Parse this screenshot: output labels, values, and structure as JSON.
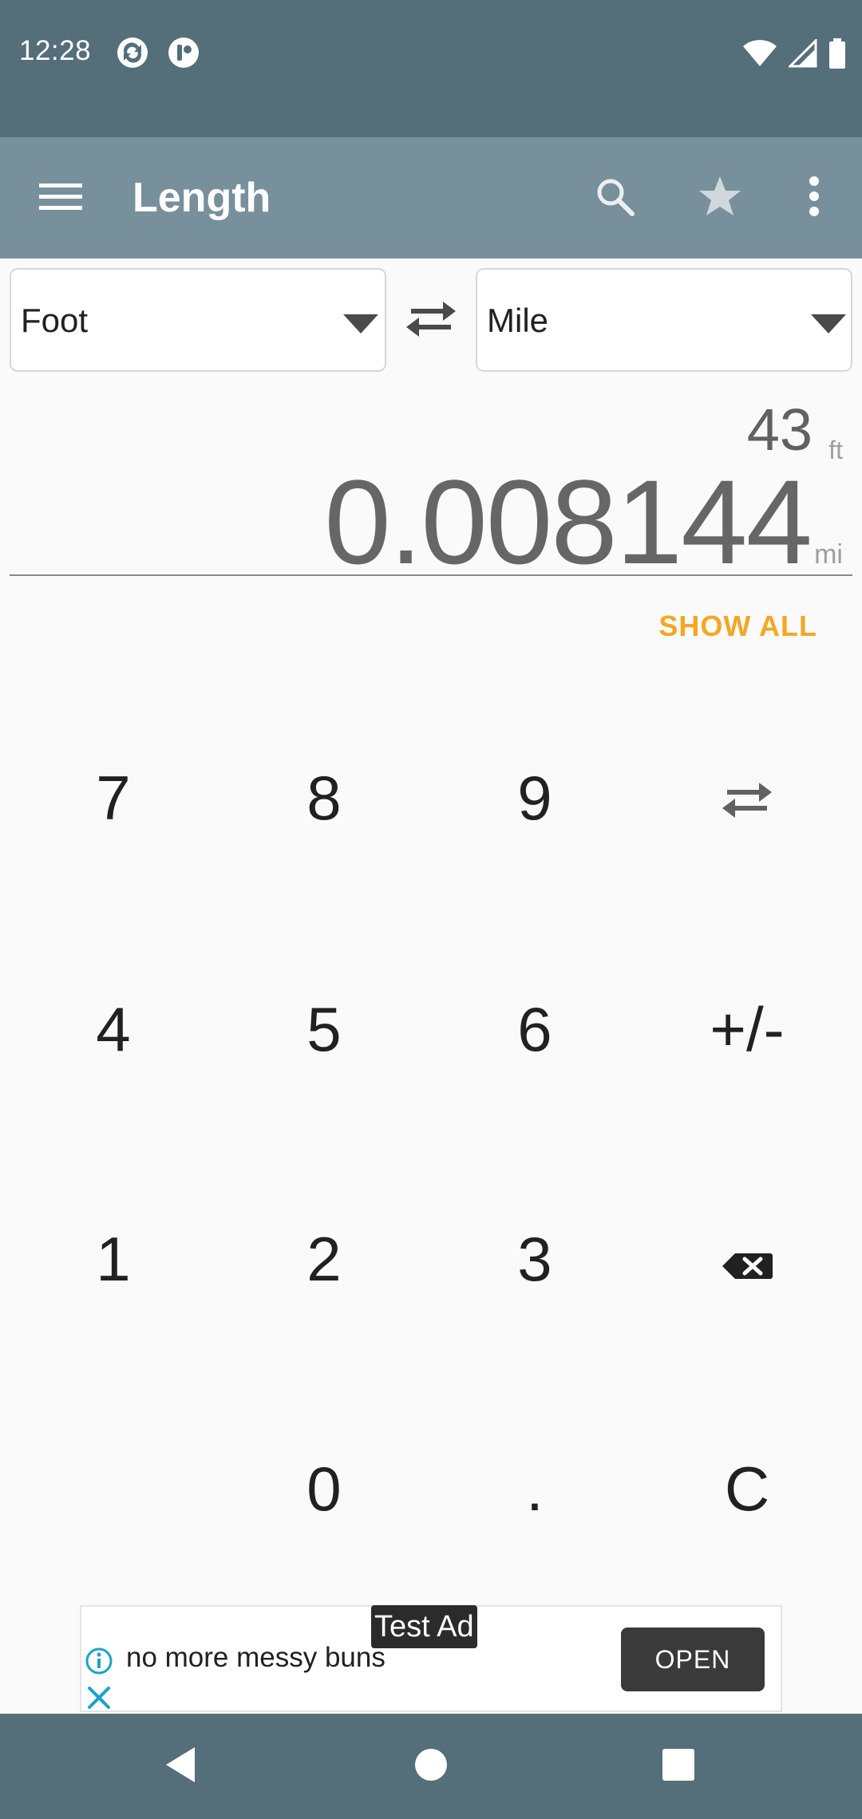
{
  "status_bar": {
    "time": "12:28",
    "icons": [
      "sync-app-icon",
      "app-notification-icon",
      "wifi-icon",
      "signal-icon",
      "battery-icon"
    ]
  },
  "app_bar": {
    "title": "Length",
    "actions": [
      "search-icon",
      "star-icon",
      "more-vert-icon"
    ]
  },
  "converter": {
    "from_unit": "Foot",
    "to_unit": "Mile",
    "input_value": "43",
    "input_unit": "ft",
    "result_value": "0.008144",
    "result_unit": "mi",
    "show_all_label": "SHOW ALL"
  },
  "keypad": {
    "keys": [
      "7",
      "8",
      "9",
      "4",
      "5",
      "6",
      "+/-",
      "1",
      "2",
      "3",
      "0",
      ".",
      "C"
    ]
  },
  "ad": {
    "badge": "Test Ad",
    "text": "no more messy buns",
    "cta": "OPEN"
  },
  "colors": {
    "status_bar": "#546e7a",
    "app_bar": "#78909c",
    "accent": "#f5a623",
    "background": "#fafafa"
  }
}
